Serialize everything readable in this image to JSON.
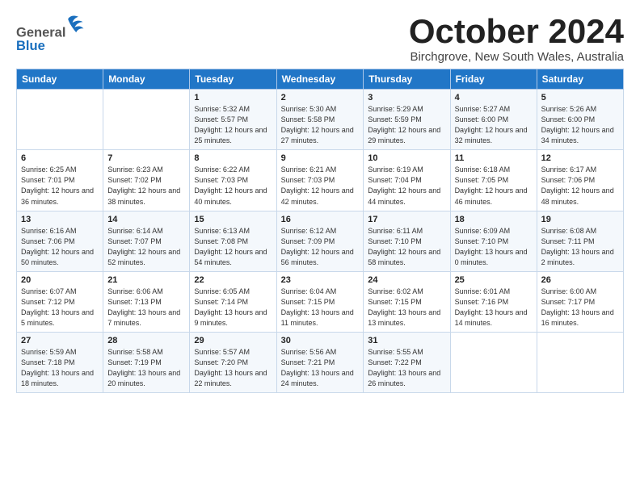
{
  "header": {
    "logo_general": "General",
    "logo_blue": "Blue",
    "month_title": "October 2024",
    "subtitle": "Birchgrove, New South Wales, Australia"
  },
  "weekdays": [
    "Sunday",
    "Monday",
    "Tuesday",
    "Wednesday",
    "Thursday",
    "Friday",
    "Saturday"
  ],
  "weeks": [
    [
      {
        "day": "",
        "info": ""
      },
      {
        "day": "",
        "info": ""
      },
      {
        "day": "1",
        "info": "Sunrise: 5:32 AM\nSunset: 5:57 PM\nDaylight: 12 hours\nand 25 minutes."
      },
      {
        "day": "2",
        "info": "Sunrise: 5:30 AM\nSunset: 5:58 PM\nDaylight: 12 hours\nand 27 minutes."
      },
      {
        "day": "3",
        "info": "Sunrise: 5:29 AM\nSunset: 5:59 PM\nDaylight: 12 hours\nand 29 minutes."
      },
      {
        "day": "4",
        "info": "Sunrise: 5:27 AM\nSunset: 6:00 PM\nDaylight: 12 hours\nand 32 minutes."
      },
      {
        "day": "5",
        "info": "Sunrise: 5:26 AM\nSunset: 6:00 PM\nDaylight: 12 hours\nand 34 minutes."
      }
    ],
    [
      {
        "day": "6",
        "info": "Sunrise: 6:25 AM\nSunset: 7:01 PM\nDaylight: 12 hours\nand 36 minutes."
      },
      {
        "day": "7",
        "info": "Sunrise: 6:23 AM\nSunset: 7:02 PM\nDaylight: 12 hours\nand 38 minutes."
      },
      {
        "day": "8",
        "info": "Sunrise: 6:22 AM\nSunset: 7:03 PM\nDaylight: 12 hours\nand 40 minutes."
      },
      {
        "day": "9",
        "info": "Sunrise: 6:21 AM\nSunset: 7:03 PM\nDaylight: 12 hours\nand 42 minutes."
      },
      {
        "day": "10",
        "info": "Sunrise: 6:19 AM\nSunset: 7:04 PM\nDaylight: 12 hours\nand 44 minutes."
      },
      {
        "day": "11",
        "info": "Sunrise: 6:18 AM\nSunset: 7:05 PM\nDaylight: 12 hours\nand 46 minutes."
      },
      {
        "day": "12",
        "info": "Sunrise: 6:17 AM\nSunset: 7:06 PM\nDaylight: 12 hours\nand 48 minutes."
      }
    ],
    [
      {
        "day": "13",
        "info": "Sunrise: 6:16 AM\nSunset: 7:06 PM\nDaylight: 12 hours\nand 50 minutes."
      },
      {
        "day": "14",
        "info": "Sunrise: 6:14 AM\nSunset: 7:07 PM\nDaylight: 12 hours\nand 52 minutes."
      },
      {
        "day": "15",
        "info": "Sunrise: 6:13 AM\nSunset: 7:08 PM\nDaylight: 12 hours\nand 54 minutes."
      },
      {
        "day": "16",
        "info": "Sunrise: 6:12 AM\nSunset: 7:09 PM\nDaylight: 12 hours\nand 56 minutes."
      },
      {
        "day": "17",
        "info": "Sunrise: 6:11 AM\nSunset: 7:10 PM\nDaylight: 12 hours\nand 58 minutes."
      },
      {
        "day": "18",
        "info": "Sunrise: 6:09 AM\nSunset: 7:10 PM\nDaylight: 13 hours\nand 0 minutes."
      },
      {
        "day": "19",
        "info": "Sunrise: 6:08 AM\nSunset: 7:11 PM\nDaylight: 13 hours\nand 2 minutes."
      }
    ],
    [
      {
        "day": "20",
        "info": "Sunrise: 6:07 AM\nSunset: 7:12 PM\nDaylight: 13 hours\nand 5 minutes."
      },
      {
        "day": "21",
        "info": "Sunrise: 6:06 AM\nSunset: 7:13 PM\nDaylight: 13 hours\nand 7 minutes."
      },
      {
        "day": "22",
        "info": "Sunrise: 6:05 AM\nSunset: 7:14 PM\nDaylight: 13 hours\nand 9 minutes."
      },
      {
        "day": "23",
        "info": "Sunrise: 6:04 AM\nSunset: 7:15 PM\nDaylight: 13 hours\nand 11 minutes."
      },
      {
        "day": "24",
        "info": "Sunrise: 6:02 AM\nSunset: 7:15 PM\nDaylight: 13 hours\nand 13 minutes."
      },
      {
        "day": "25",
        "info": "Sunrise: 6:01 AM\nSunset: 7:16 PM\nDaylight: 13 hours\nand 14 minutes."
      },
      {
        "day": "26",
        "info": "Sunrise: 6:00 AM\nSunset: 7:17 PM\nDaylight: 13 hours\nand 16 minutes."
      }
    ],
    [
      {
        "day": "27",
        "info": "Sunrise: 5:59 AM\nSunset: 7:18 PM\nDaylight: 13 hours\nand 18 minutes."
      },
      {
        "day": "28",
        "info": "Sunrise: 5:58 AM\nSunset: 7:19 PM\nDaylight: 13 hours\nand 20 minutes."
      },
      {
        "day": "29",
        "info": "Sunrise: 5:57 AM\nSunset: 7:20 PM\nDaylight: 13 hours\nand 22 minutes."
      },
      {
        "day": "30",
        "info": "Sunrise: 5:56 AM\nSunset: 7:21 PM\nDaylight: 13 hours\nand 24 minutes."
      },
      {
        "day": "31",
        "info": "Sunrise: 5:55 AM\nSunset: 7:22 PM\nDaylight: 13 hours\nand 26 minutes."
      },
      {
        "day": "",
        "info": ""
      },
      {
        "day": "",
        "info": ""
      }
    ]
  ]
}
